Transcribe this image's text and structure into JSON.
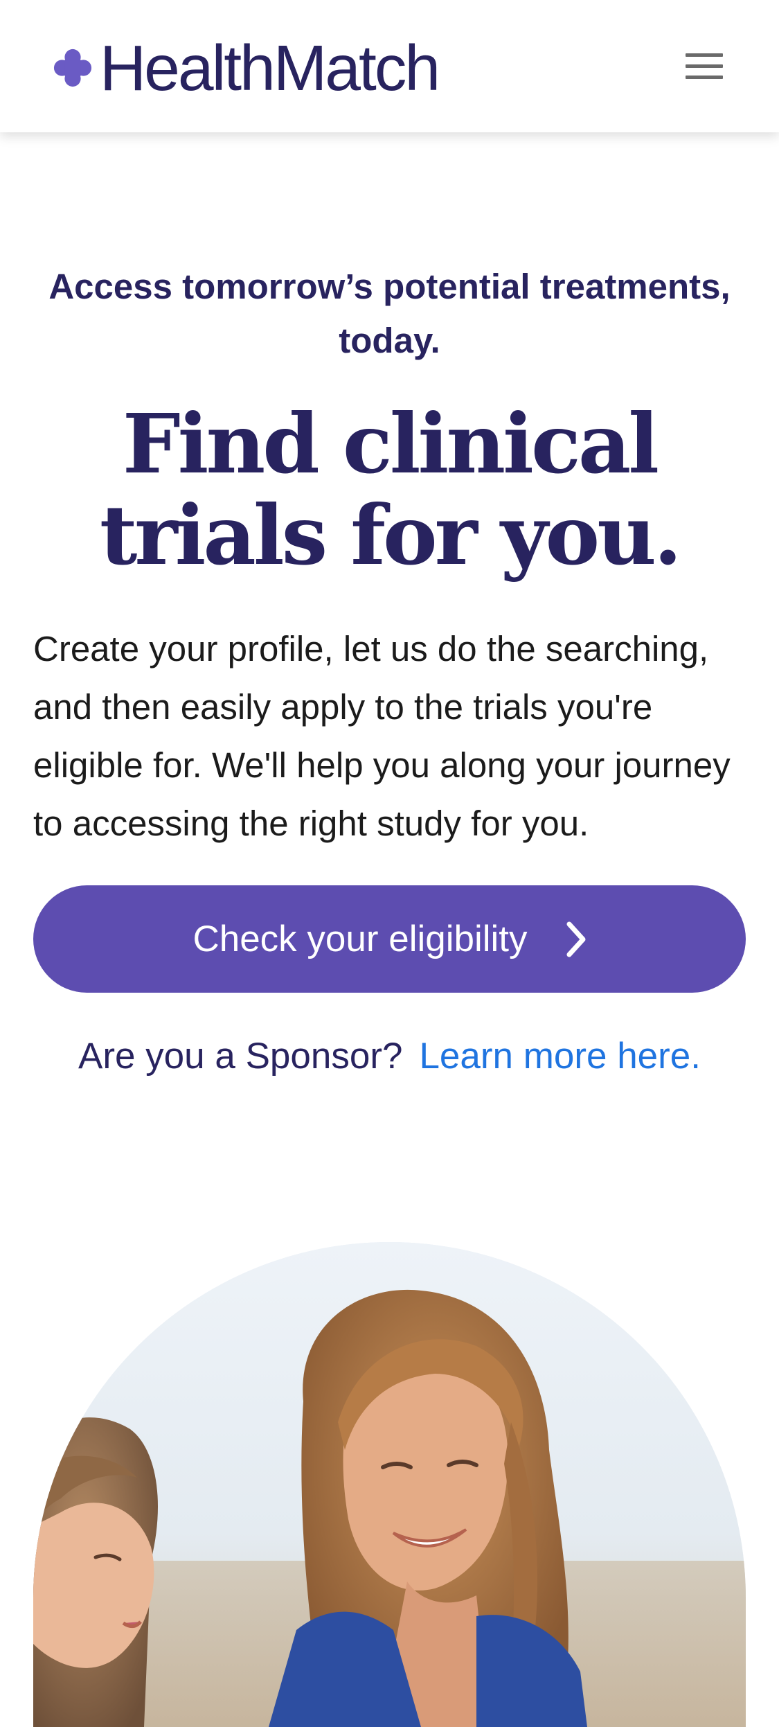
{
  "header": {
    "logo_text": "HealthMatch",
    "logo_icon": "plus-cross-logo-icon",
    "menu_icon": "hamburger-menu-icon"
  },
  "hero": {
    "tagline": "Access tomorrow’s potential treatments, today.",
    "headline": "Find clinical trials for you.",
    "description": "Create your profile, let us do the searching, and then easily apply to the trials you're eligible for. We'll help you along your journey to accessing the right study for you.",
    "cta_label": "Check your eligibility",
    "cta_icon": "chevron-right-icon"
  },
  "sponsor": {
    "question": "Are you a Sponsor?",
    "link_text": "Learn more here."
  },
  "image": {
    "description_icon": "photo-two-women-smiling"
  },
  "colors": {
    "brand_navy": "#28235f",
    "brand_purple": "#5d4db0",
    "link_blue": "#1f74e0",
    "logo_purple": "#6a5bc4"
  }
}
